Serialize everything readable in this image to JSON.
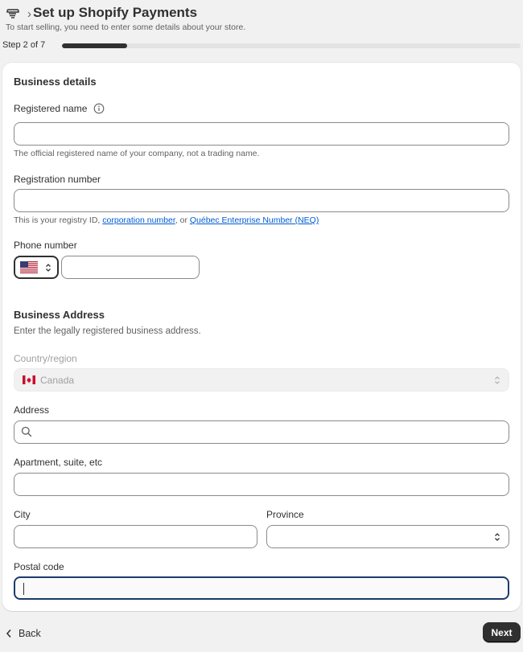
{
  "header": {
    "title": "Set up Shopify Payments",
    "separator": "›",
    "subtitle": "To start selling, you need to enter some details about your store.",
    "icon": "payments-icon"
  },
  "progress": {
    "step_label": "Step 2 of 7",
    "current": 2,
    "total": 7
  },
  "business_details": {
    "title": "Business details",
    "registered_name": {
      "label": "Registered name",
      "value": "",
      "help": "The official registered name of your company, not a trading name.",
      "info_icon": "info-icon"
    },
    "registration_number": {
      "label": "Registration number",
      "value": "",
      "help_prefix": "This is your registry ID, ",
      "link_corporation": "corporation number",
      "help_mid": ", or ",
      "link_neq": "Québec Enterprise Number (NEQ)"
    },
    "phone": {
      "label": "Phone number",
      "country_flag": "us-flag-icon",
      "value": ""
    }
  },
  "business_address": {
    "title": "Business Address",
    "description": "Enter the legally registered business address.",
    "country": {
      "label": "Country/region",
      "value": "Canada",
      "flag": "canada-flag-icon"
    },
    "address": {
      "label": "Address",
      "value": ""
    },
    "apartment": {
      "label": "Apartment, suite, etc",
      "value": ""
    },
    "city": {
      "label": "City",
      "value": ""
    },
    "province": {
      "label": "Province",
      "value": ""
    },
    "postal_code": {
      "label": "Postal code",
      "value": ""
    }
  },
  "footer": {
    "back_label": "Back",
    "next_label": "Next"
  },
  "colors": {
    "primary": "#303030",
    "link": "#005bd3",
    "focus": "#1d3a6e",
    "background": "#f1f1f1"
  }
}
